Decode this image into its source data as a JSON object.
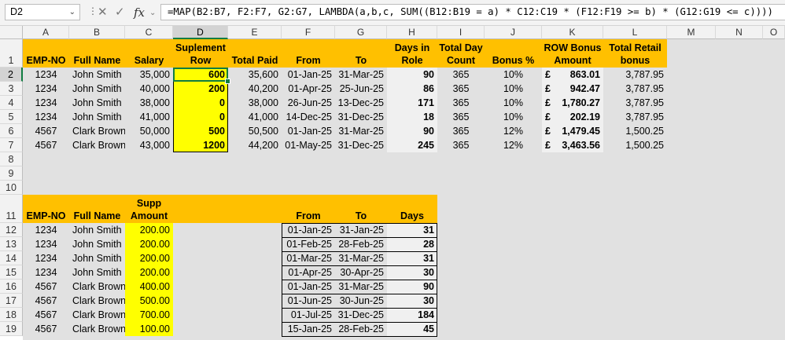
{
  "formula_bar": {
    "name_box": "D2",
    "formula": "=MAP(B2:B7, F2:F7, G2:G7, LAMBDA(a,b,c, SUM((B12:B19 = a) * C12:C19 * (F12:F19 >= b) * (G12:G19 <= c))))",
    "fx": "fx"
  },
  "columns": [
    "A",
    "B",
    "C",
    "D",
    "E",
    "F",
    "G",
    "H",
    "I",
    "J",
    "K",
    "L",
    "M",
    "N",
    "O"
  ],
  "rows": [
    "1",
    "2",
    "3",
    "4",
    "5",
    "6",
    "7",
    "8",
    "9",
    "10",
    "11",
    "12",
    "13",
    "14",
    "15",
    "16",
    "17",
    "18",
    "19"
  ],
  "table1": {
    "headers": [
      "EMP-NO",
      "Full Name",
      "Salary",
      "Suplement Row",
      "Total Paid",
      "From",
      "To",
      "Days in Role",
      "Total Day Count",
      "Bonus %",
      "ROW Bonus Amount",
      "Total Retail bonus"
    ],
    "rows": [
      [
        "1234",
        "John Smith",
        "35,000",
        "600",
        "35,600",
        "01-Jan-25",
        "31-Mar-25",
        "90",
        "365",
        "10%",
        "£",
        "863.01",
        "3,787.95"
      ],
      [
        "1234",
        "John Smith",
        "40,000",
        "200",
        "40,200",
        "01-Apr-25",
        "25-Jun-25",
        "86",
        "365",
        "10%",
        "£",
        "942.47",
        "3,787.95"
      ],
      [
        "1234",
        "John Smith",
        "38,000",
        "0",
        "38,000",
        "26-Jun-25",
        "13-Dec-25",
        "171",
        "365",
        "10%",
        "£",
        "1,780.27",
        "3,787.95"
      ],
      [
        "1234",
        "John Smith",
        "41,000",
        "0",
        "41,000",
        "14-Dec-25",
        "31-Dec-25",
        "18",
        "365",
        "10%",
        "£",
        "202.19",
        "3,787.95"
      ],
      [
        "4567",
        "Clark Brown",
        "50,000",
        "500",
        "50,500",
        "01-Jan-25",
        "31-Mar-25",
        "90",
        "365",
        "12%",
        "£",
        "1,479.45",
        "1,500.25"
      ],
      [
        "4567",
        "Clark Brown",
        "43,000",
        "1200",
        "44,200",
        "01-May-25",
        "31-Dec-25",
        "245",
        "365",
        "12%",
        "£",
        "3,463.56",
        "1,500.25"
      ]
    ]
  },
  "table2": {
    "headers": [
      "EMP-NO",
      "Full Name",
      "Supp Amount",
      "From",
      "To",
      "Days"
    ],
    "rows": [
      [
        "1234",
        "John Smith",
        "200.00",
        "01-Jan-25",
        "31-Jan-25",
        "31"
      ],
      [
        "1234",
        "John Smith",
        "200.00",
        "01-Feb-25",
        "28-Feb-25",
        "28"
      ],
      [
        "1234",
        "John Smith",
        "200.00",
        "01-Mar-25",
        "31-Mar-25",
        "31"
      ],
      [
        "1234",
        "John Smith",
        "200.00",
        "01-Apr-25",
        "30-Apr-25",
        "30"
      ],
      [
        "4567",
        "Clark Brown",
        "400.00",
        "01-Jan-25",
        "31-Mar-25",
        "90"
      ],
      [
        "4567",
        "Clark Brown",
        "500.00",
        "01-Jun-25",
        "30-Jun-25",
        "30"
      ],
      [
        "4567",
        "Clark Brown",
        "700.00",
        "01-Jul-25",
        "31-Dec-25",
        "184"
      ],
      [
        "4567",
        "Clark Brown",
        "100.00",
        "15-Jan-25",
        "28-Feb-25",
        "45"
      ]
    ]
  },
  "colors": {
    "header_orange": "#ffc000",
    "highlight_yellow": "#ffff00",
    "selection_green": "#107c41"
  }
}
